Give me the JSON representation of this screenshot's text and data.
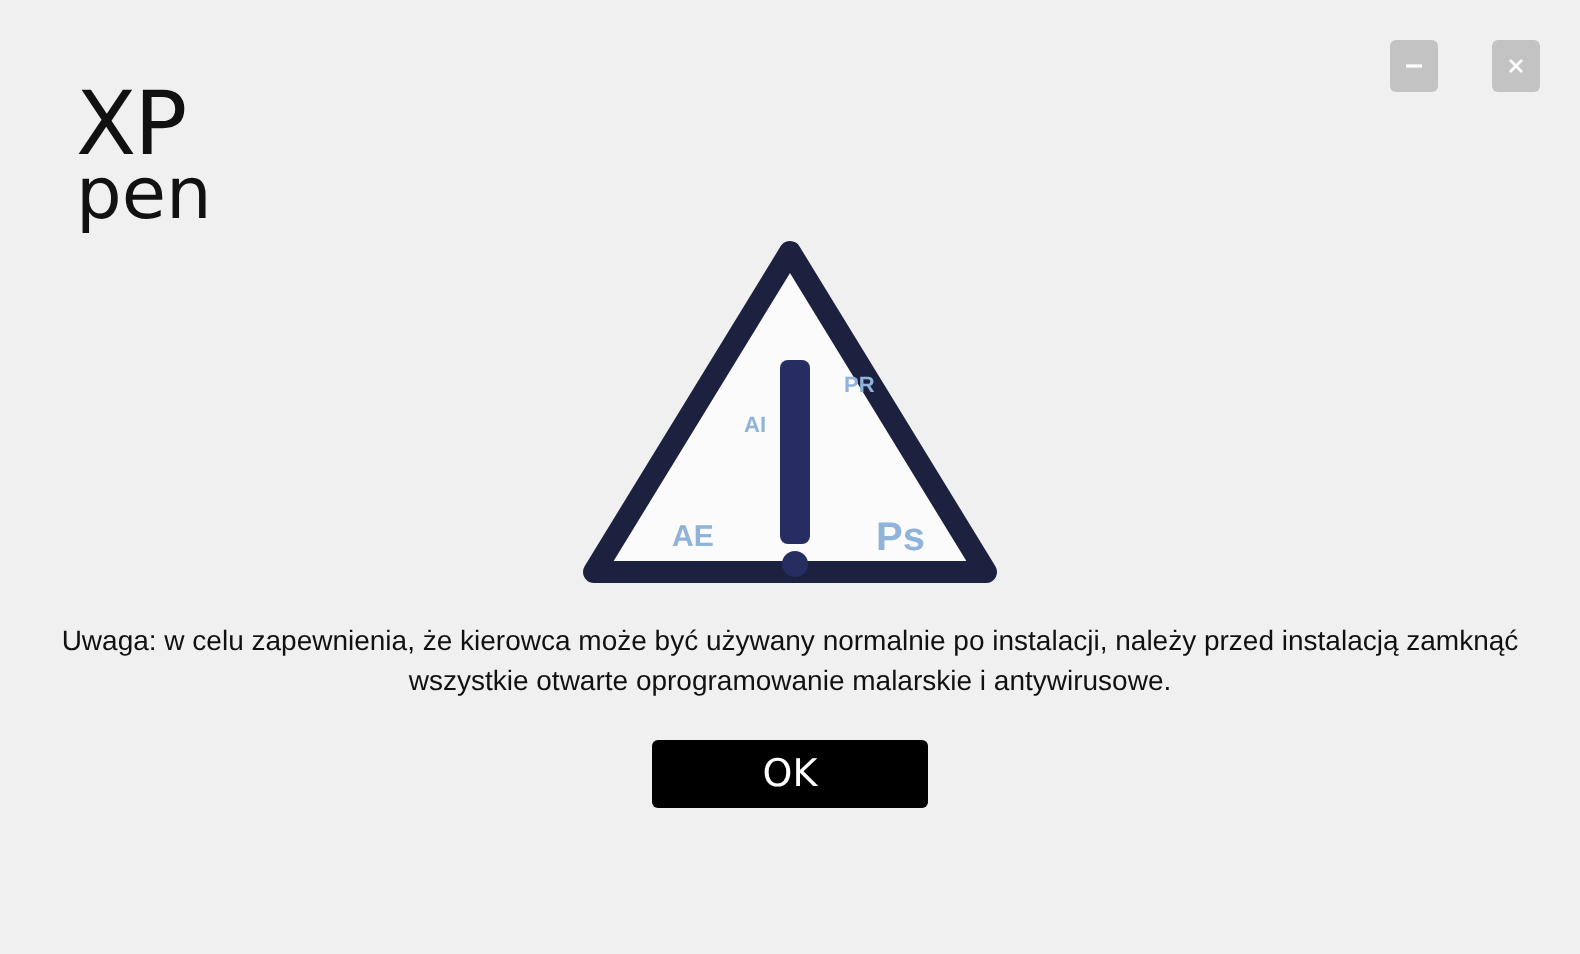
{
  "logo": {
    "line_1": "XP",
    "line_2": "pen"
  },
  "window_controls": [
    {
      "kind": "minimize"
    },
    {
      "kind": "close"
    }
  ],
  "warning_graphic": {
    "labels": [
      {
        "text": "PR",
        "kind": "small"
      },
      {
        "text": "AI",
        "kind": "small"
      },
      {
        "text": "AE",
        "kind": "medium"
      },
      {
        "text": "Ps",
        "kind": "large"
      }
    ]
  },
  "message": "Uwaga: w celu zapewnienia, że kierowca może być używany normalnie po instalacji, należy przed instalacją zamknąć wszystkie otwarte oprogramowanie malarskie i antywirusowe.",
  "buttons": [
    "OK"
  ]
}
